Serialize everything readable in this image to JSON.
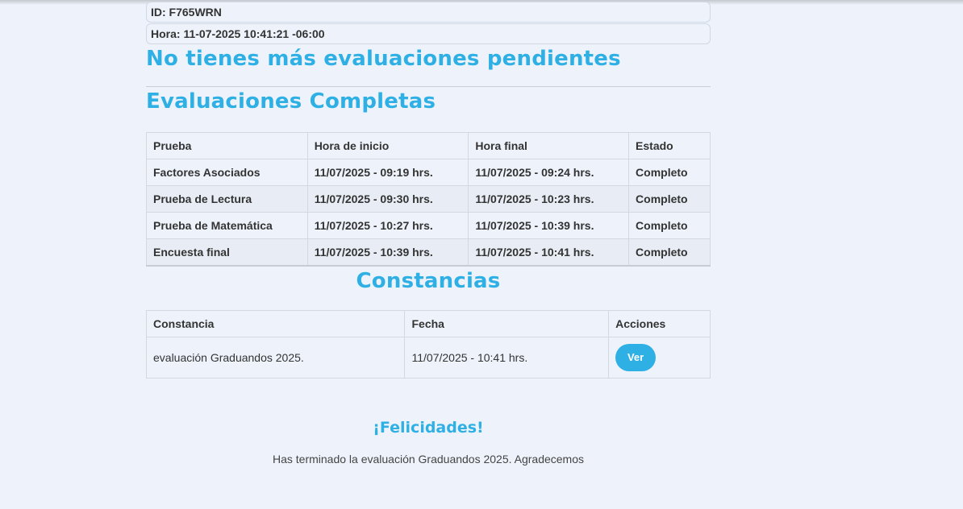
{
  "header": {
    "id_text": "ID: F765WRN",
    "hora_text": "Hora: 11-07-2025 10:41:21 -06:00"
  },
  "pending_title": "No tienes más evaluaciones pendientes",
  "completed": {
    "title": "Evaluaciones Completas",
    "columns": [
      "Prueba",
      "Hora de inicio",
      "Hora final",
      "Estado"
    ],
    "rows": [
      [
        "Factores Asociados",
        "11/07/2025 - 09:19 hrs.",
        "11/07/2025 - 09:24 hrs.",
        "Completo"
      ],
      [
        "Prueba de Lectura",
        "11/07/2025 - 09:30 hrs.",
        "11/07/2025 - 10:23 hrs.",
        "Completo"
      ],
      [
        "Prueba de Matemática",
        "11/07/2025 - 10:27 hrs.",
        "11/07/2025 - 10:39 hrs.",
        "Completo"
      ],
      [
        "Encuesta final",
        "11/07/2025 - 10:39 hrs.",
        "11/07/2025 - 10:41 hrs.",
        "Completo"
      ]
    ]
  },
  "constancias": {
    "title": "Constancias",
    "columns": [
      "Constancia",
      "Fecha",
      "Acciones"
    ],
    "rows": [
      [
        "evaluación Graduandos 2025.",
        "11/07/2025 - 10:41 hrs.",
        "Ver"
      ]
    ]
  },
  "congrats": {
    "title": "¡Felicidades!",
    "message": "Has terminado la evaluación Graduandos 2025. Agradecemos"
  },
  "colors": {
    "accent": "#2fb0e5",
    "background": "#eef3fb"
  }
}
